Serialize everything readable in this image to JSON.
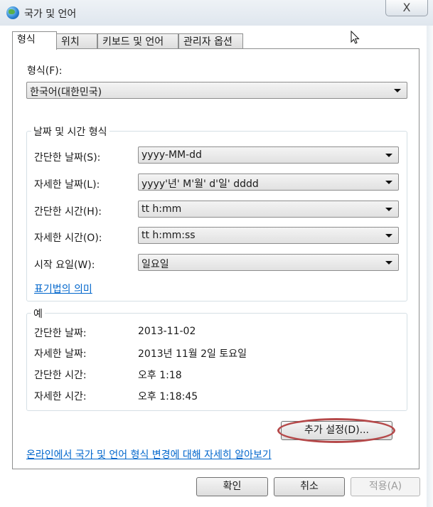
{
  "window": {
    "title": "국가 및 언어",
    "close_symbol": "X"
  },
  "tabs": [
    {
      "label": "형식",
      "active": true
    },
    {
      "label": "위치",
      "active": false
    },
    {
      "label": "키보드 및 언어",
      "active": false
    },
    {
      "label": "관리자 옵션",
      "active": false
    }
  ],
  "format": {
    "label": "형식(F):",
    "value": "한국어(대한민국)"
  },
  "datetime_group": {
    "title": "날짜 및 시간 형식",
    "rows": [
      {
        "label": "간단한 날짜(S):",
        "value": "yyyy-MM-dd"
      },
      {
        "label": "자세한 날짜(L):",
        "value": "yyyy'년' M'월' d'일' dddd"
      },
      {
        "label": "간단한 시간(H):",
        "value": "tt h:mm"
      },
      {
        "label": "자세한 시간(O):",
        "value": "tt h:mm:ss"
      },
      {
        "label": "시작 요일(W):",
        "value": "일요일"
      }
    ],
    "notation_link": "표기법의 의미"
  },
  "example_group": {
    "title": "예",
    "rows": [
      {
        "label": "간단한 날짜:",
        "value": "2013-11-02"
      },
      {
        "label": "자세한 날짜:",
        "value": "2013년 11월 2일 토요일"
      },
      {
        "label": "간단한 시간:",
        "value": "오후 1:18"
      },
      {
        "label": "자세한 시간:",
        "value": "오후 1:18:45"
      }
    ]
  },
  "additional_settings_button": "추가 설정(D)...",
  "online_link": "온라인에서 국가 및 언어 형식 변경에 대해 자세히 알아보기",
  "footer": {
    "ok": "확인",
    "cancel": "취소",
    "apply": "적용(A)"
  },
  "colors": {
    "link": "#0066cc",
    "highlight": "#b5494a"
  }
}
